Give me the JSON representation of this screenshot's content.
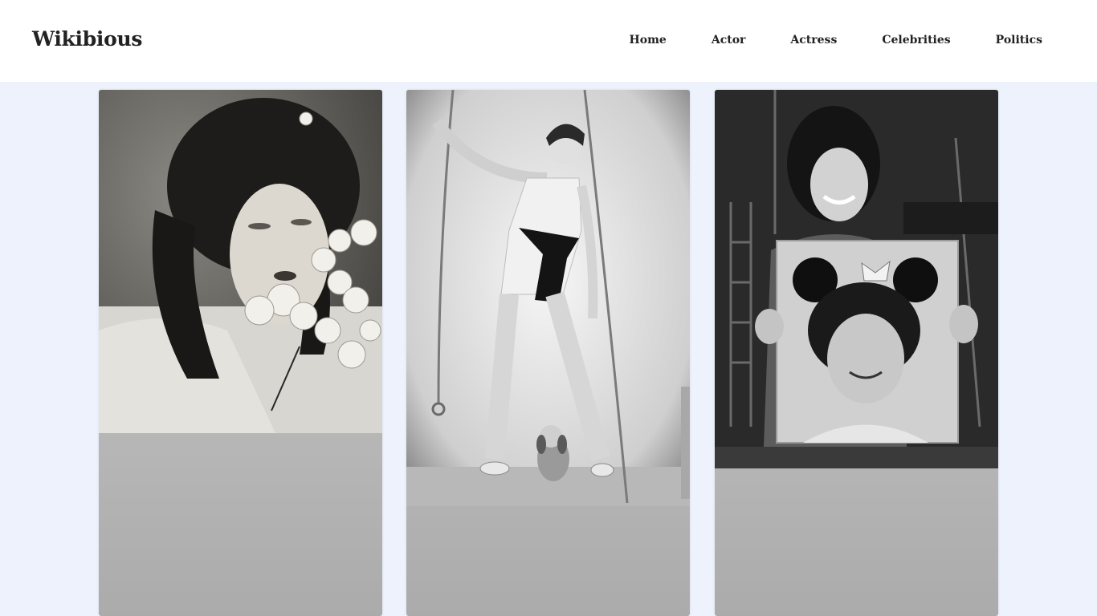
{
  "site": {
    "title": "Wikibious"
  },
  "nav": {
    "items": [
      "Home",
      "Actor",
      "Actress",
      "Celebrities",
      "Politics"
    ]
  },
  "cards": [
    {
      "image": "vintage-portrait-woman-flowers-photo"
    },
    {
      "image": "vintage-woman-swimsuit-ropes-dog-photo"
    },
    {
      "image": "woman-holding-mouse-ears-portrait-photo"
    }
  ],
  "colors": {
    "page_background": "#eef2fd",
    "header_background": "#ffffff",
    "text": "#222222"
  }
}
